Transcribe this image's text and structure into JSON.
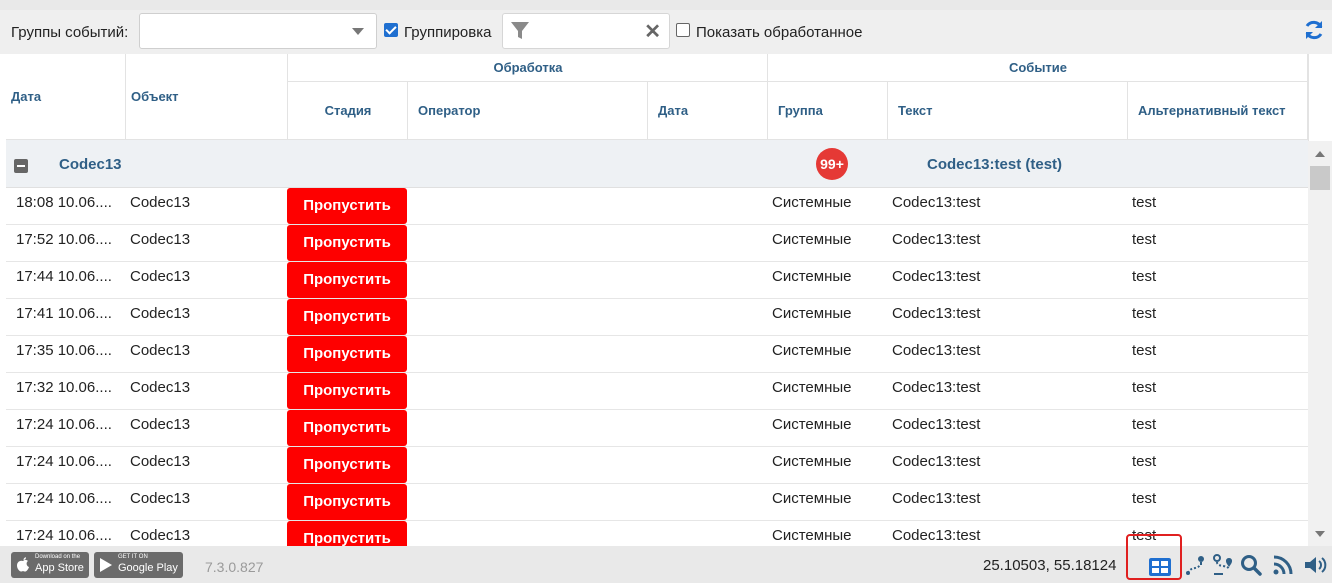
{
  "toolbar": {
    "groups_label": "Группы событий:",
    "groups_value": "",
    "grouping_label": "Группировка",
    "grouping_checked": true,
    "filter_value": "",
    "show_processed_label": "Показать обработанное",
    "show_processed_checked": false
  },
  "headers": {
    "date": "Дата",
    "object": "Объект",
    "processing": "Обработка",
    "event": "Событие",
    "stage": "Стадия",
    "operator": "Оператор",
    "proc_date": "Дата",
    "group": "Группа",
    "text": "Текст",
    "alt_text": "Альтернативный текст"
  },
  "group_row": {
    "name": "Codec13",
    "badge": "99+",
    "event_text": "Codec13:test (test)"
  },
  "rows": [
    {
      "date": "18:08 10.06....",
      "object": "Codec13",
      "action": "Пропустить",
      "group": "Системные",
      "text": "Codec13:test",
      "alt": "test"
    },
    {
      "date": "17:52 10.06....",
      "object": "Codec13",
      "action": "Пропустить",
      "group": "Системные",
      "text": "Codec13:test",
      "alt": "test"
    },
    {
      "date": "17:44 10.06....",
      "object": "Codec13",
      "action": "Пропустить",
      "group": "Системные",
      "text": "Codec13:test",
      "alt": "test"
    },
    {
      "date": "17:41 10.06....",
      "object": "Codec13",
      "action": "Пропустить",
      "group": "Системные",
      "text": "Codec13:test",
      "alt": "test"
    },
    {
      "date": "17:35 10.06....",
      "object": "Codec13",
      "action": "Пропустить",
      "group": "Системные",
      "text": "Codec13:test",
      "alt": "test"
    },
    {
      "date": "17:32 10.06....",
      "object": "Codec13",
      "action": "Пропустить",
      "group": "Системные",
      "text": "Codec13:test",
      "alt": "test"
    },
    {
      "date": "17:24 10.06....",
      "object": "Codec13",
      "action": "Пропустить",
      "group": "Системные",
      "text": "Codec13:test",
      "alt": "test"
    },
    {
      "date": "17:24 10.06....",
      "object": "Codec13",
      "action": "Пропустить",
      "group": "Системные",
      "text": "Codec13:test",
      "alt": "test"
    },
    {
      "date": "17:24 10.06....",
      "object": "Codec13",
      "action": "Пропустить",
      "group": "Системные",
      "text": "Codec13:test",
      "alt": "test"
    },
    {
      "date": "17:24 10.06....",
      "object": "Codec13",
      "action": "Пропустить",
      "group": "Системные",
      "text": "Codec13:test",
      "alt": "test"
    }
  ],
  "footer": {
    "appstore_small": "Download on the",
    "appstore_big": "App Store",
    "googleplay_small": "GET IT ON",
    "googleplay_big": "Google Play",
    "version": "7.3.0.827",
    "coords": "25.10503, 55.18124"
  },
  "colors": {
    "accent": "#1f6fd0",
    "skip_button": "#fe0000",
    "badge": "#e53935",
    "header_text": "#2f5f86"
  },
  "icons": [
    "chevron-down-icon",
    "checkbox-icon",
    "filter-icon",
    "close-icon",
    "refresh-icon",
    "collapse-icon",
    "apple-icon",
    "google-play-icon",
    "layout-grid-icon",
    "route-icon",
    "route-pin-icon",
    "search-zoom-icon",
    "rss-icon",
    "volume-icon"
  ]
}
